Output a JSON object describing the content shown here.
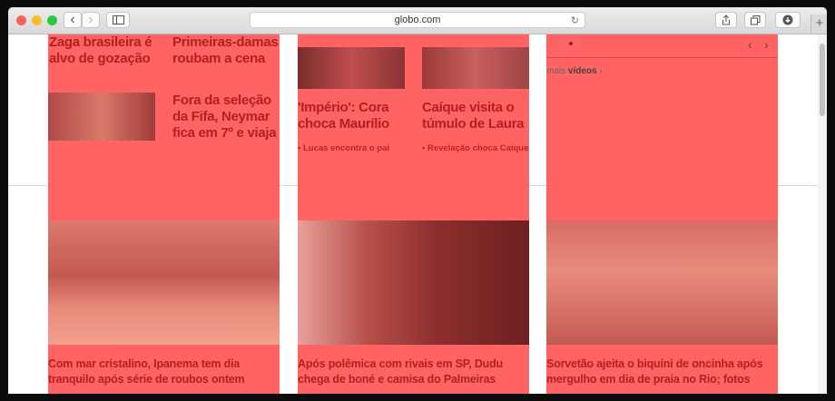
{
  "browser": {
    "url": "globo.com",
    "back_icon": "‹",
    "forward_icon": "›",
    "reload_icon": "↻",
    "new_tab_icon": "+"
  },
  "col1": {
    "headline_a": "Zaga brasileira é\nalvo de gozação",
    "headline_b": "Primeiras-damas\nroubam a cena",
    "headline_c": "Fora da seleção\nda Fifa, Neymar\nfica em 7º e viaja",
    "caption": "Com mar cristalino, Ipanema tem dia tranquilo após série de roubos ontem"
  },
  "col2": {
    "headline_a": "'Império': Cora\nchoca Maurílio",
    "sub_a": "Lucas encontra o pai",
    "headline_b": "Caíque visita o\ntúmulo de Laura",
    "sub_b": "Revelação choca Caíque",
    "caption": "Após polêmica com rivais em SP, Dudu chega de boné e camisa do Palmeiras"
  },
  "col3": {
    "more_videos_prefix": "mais",
    "more_videos": "vídeos",
    "more_arrow": "›",
    "caption": "Sorvetão ajeita o biquíni de oncinha após mergulho em dia de praia no Rio; fotos"
  }
}
